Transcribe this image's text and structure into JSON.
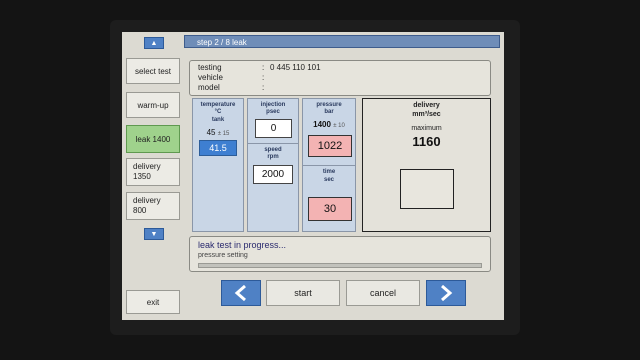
{
  "header": {
    "step": "step 2 / 8 leak"
  },
  "sidebar": {
    "up_arrow": "▲",
    "down_arrow": "▼",
    "items": [
      {
        "label": "select test"
      },
      {
        "label": "warm-up"
      },
      {
        "label": "leak 1400",
        "active": true
      },
      {
        "label": "delivery 1350"
      },
      {
        "label": "delivery 800"
      }
    ],
    "exit": "exit"
  },
  "info": {
    "testing_label": "testing",
    "testing_value": "0 445 110 101",
    "vehicle_label": "vehicle",
    "vehicle_value": "",
    "model_label": "model",
    "model_value": "",
    "colon": ":"
  },
  "temperature": {
    "title": "temperature",
    "unit": "°C",
    "sublabel": "tank",
    "setpoint": "45",
    "tolerance": "± 15",
    "value": "41.5"
  },
  "injection": {
    "title": "injection",
    "unit": "psec",
    "value": "0"
  },
  "speed": {
    "title": "speed",
    "unit": "rpm",
    "value": "2000"
  },
  "pressure": {
    "title": "pressure",
    "unit": "bar",
    "setpoint": "1400",
    "tolerance": "± 10",
    "value": "1022"
  },
  "time": {
    "title": "time",
    "unit": "sec",
    "value": "30"
  },
  "delivery": {
    "title": "delivery",
    "unit": "mm³/sec",
    "max_label": "maximum",
    "max_value": "1160",
    "value": ""
  },
  "status": {
    "message": "leak test in progress...",
    "sub": "pressure setting"
  },
  "controls": {
    "start": "start",
    "cancel": "cancel",
    "back_icon": "chevron-left-icon",
    "forward_icon": "chevron-right-icon"
  },
  "colors": {
    "header": "#6f8db8",
    "active": "#9fd28c",
    "alert_red": "#f3b3b3",
    "temp_blue": "#3e7fd1",
    "nav_blue": "#4f81c5"
  }
}
